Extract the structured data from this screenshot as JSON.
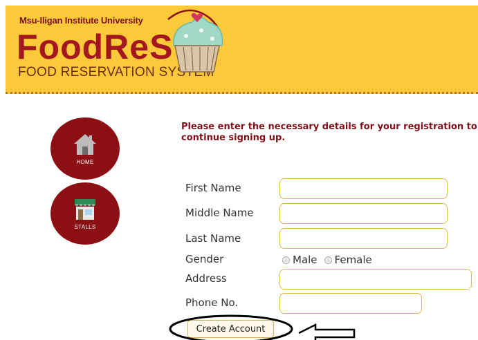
{
  "header": {
    "institution": "Msu-Iligan Institute University",
    "app_name": "FoodReS",
    "subtitle": "FOOD RESERVATION SYSTEM"
  },
  "nav": {
    "home_label": "HOME",
    "stalls_label": "STALLS"
  },
  "instructions": {
    "line1": "Please enter the necessary details for your registration to",
    "line2": "continue signing up."
  },
  "form": {
    "first_name_label": "First Name",
    "middle_name_label": "Middle Name",
    "last_name_label": "Last Name",
    "gender_label": "Gender",
    "gender_options": [
      "Male",
      "Female"
    ],
    "address_label": "Address",
    "phone_label": "Phone No.",
    "submit_label": "Create Account"
  },
  "colors": {
    "banner": "#fcc93a",
    "brand": "#a3181f",
    "nav": "#8c0f14"
  }
}
